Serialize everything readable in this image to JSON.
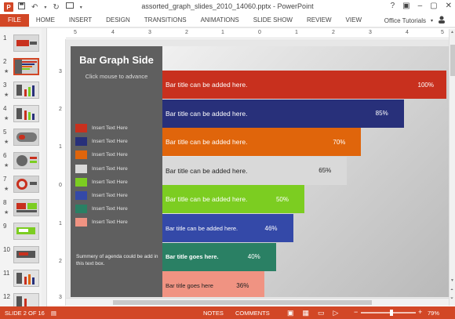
{
  "window": {
    "title": "assorted_graph_slides_2010_14060.pptx - PowerPoint",
    "app_icon": "P",
    "help": "?",
    "account": "Office Tutorials"
  },
  "ribbon_tabs": [
    "FILE",
    "HOME",
    "INSERT",
    "DESIGN",
    "TRANSITIONS",
    "ANIMATIONS",
    "SLIDE SHOW",
    "REVIEW",
    "VIEW"
  ],
  "thumbnails": {
    "numbers": [
      "1",
      "2",
      "3",
      "4",
      "5",
      "6",
      "7",
      "8",
      "9",
      "10",
      "11",
      "12"
    ],
    "star": "★",
    "selected_index": 1
  },
  "rulers": {
    "horizontal": [
      "5",
      "4",
      "3",
      "2",
      "1",
      "0",
      "1",
      "2",
      "3",
      "4",
      "5"
    ],
    "vertical": [
      "3",
      "2",
      "1",
      "0",
      "1",
      "2",
      "3"
    ]
  },
  "slide": {
    "title": "Bar Graph Side",
    "subtitle": "Click mouse to advance",
    "legend": [
      {
        "label": "Insert Text Here",
        "color": "#c8301e"
      },
      {
        "label": "Insert Text Here",
        "color": "#28307a"
      },
      {
        "label": "Insert Text Here",
        "color": "#e0650b"
      },
      {
        "label": "Insert Text Here",
        "color": "#d9d9d9"
      },
      {
        "label": "Insert Text Here",
        "color": "#7ccd21"
      },
      {
        "label": "Insert Text Here",
        "color": "#3449a8"
      },
      {
        "label": "Insert Text Here",
        "color": "#2a8064"
      },
      {
        "label": "Insert Text Here",
        "color": "#f09382"
      }
    ],
    "summary": "Summery of agenda could be add in this text box."
  },
  "chart_data": {
    "type": "bar",
    "orientation": "horizontal",
    "categories": [
      "Bar title can be added here.",
      "Bar title can be added here.",
      "Bar title can be added here.",
      "Bar title can be added here.",
      "Bar title can be added here.",
      "Bar title can be added here.",
      "Bar title goes here.",
      "Bar title goes here"
    ],
    "values": [
      100,
      85,
      70,
      65,
      50,
      46,
      40,
      36
    ],
    "value_labels": [
      "100%",
      "85%",
      "70%",
      "65%",
      "50%",
      "46%",
      "40%",
      "36%"
    ],
    "colors": [
      "#c8301e",
      "#28307a",
      "#e0650b",
      "#d9d9d9",
      "#7ccd21",
      "#3449a8",
      "#2a8064",
      "#f09382"
    ],
    "xlim": [
      0,
      100
    ]
  },
  "status": {
    "slide_info": "SLIDE 2 OF 16",
    "notes": "NOTES",
    "comments": "COMMENTS",
    "zoom": "79%"
  }
}
